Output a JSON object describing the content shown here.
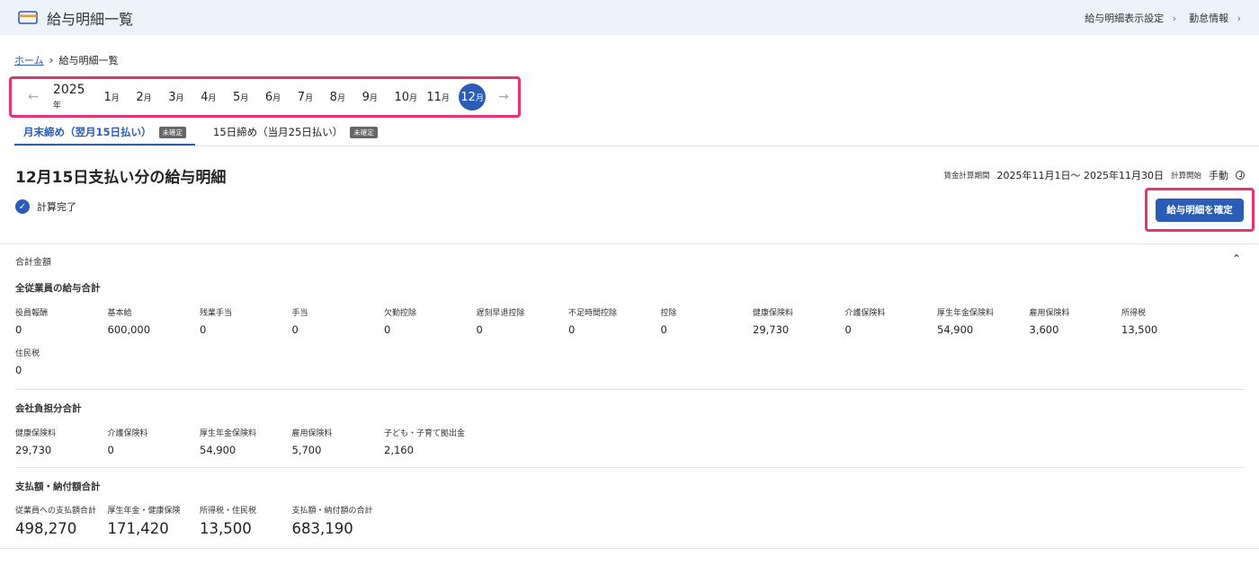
{
  "header": {
    "title": "給与明細一覧",
    "links": [
      "給与明細表示設定",
      "勤怠情報"
    ]
  },
  "breadcrumb": {
    "home": "ホーム",
    "current": "給与明細一覧"
  },
  "months": {
    "year": "2025",
    "year_unit": "年",
    "month_unit": "月",
    "items": [
      "1",
      "2",
      "3",
      "4",
      "5",
      "6",
      "7",
      "8",
      "9",
      "10",
      "11"
    ],
    "active": "12"
  },
  "tabs": [
    {
      "label": "月末締め（翌月15日払い）",
      "badge": "未確定"
    },
    {
      "label": "15日締め（当月25日払い）",
      "badge": "未確定"
    }
  ],
  "main": {
    "heading": "12月15日支払い分の給与明細",
    "period_label": "賃金計算期間",
    "period_value": "2025年11月1日～ 2025年11月30日",
    "calc_label": "計算開始",
    "calc_value": "手動",
    "status": "計算完了",
    "confirm_button": "給与明細を確定",
    "section": "合計金額"
  },
  "employee_totals": {
    "title": "全従業員の給与合計",
    "items": [
      {
        "k": "役員報酬",
        "v": "0"
      },
      {
        "k": "基本給",
        "v": "600,000"
      },
      {
        "k": "残業手当",
        "v": "0"
      },
      {
        "k": "手当",
        "v": "0"
      },
      {
        "k": "欠勤控除",
        "v": "0"
      },
      {
        "k": "遅刻早退控除",
        "v": "0"
      },
      {
        "k": "不足時間控除",
        "v": "0"
      },
      {
        "k": "控除",
        "v": "0"
      },
      {
        "k": "健康保険料",
        "v": "29,730"
      },
      {
        "k": "介護保険料",
        "v": "0"
      },
      {
        "k": "厚生年金保険料",
        "v": "54,900"
      },
      {
        "k": "雇用保険料",
        "v": "3,600"
      },
      {
        "k": "所得税",
        "v": "13,500"
      },
      {
        "k": "住民税",
        "v": "0"
      }
    ]
  },
  "company_totals": {
    "title": "会社負担分合計",
    "items": [
      {
        "k": "健康保険料",
        "v": "29,730"
      },
      {
        "k": "介護保険料",
        "v": "0"
      },
      {
        "k": "厚生年金保険料",
        "v": "54,900"
      },
      {
        "k": "雇用保険料",
        "v": "5,700"
      },
      {
        "k": "子ども・子育て拠出金",
        "v": "2,160"
      }
    ]
  },
  "payment_totals": {
    "title": "支払額・納付額合計",
    "items": [
      {
        "k": "従業員への支払額合計",
        "v": "498,270"
      },
      {
        "k": "厚生年金・健康保険",
        "v": "171,420"
      },
      {
        "k": "所得税・住民税",
        "v": "13,500"
      },
      {
        "k": "支払額・納付額の合計",
        "v": "683,190"
      }
    ]
  },
  "colors": {
    "accent": "#2a5cb8",
    "highlight": "#e8336e",
    "header_bg": "#eef2fb"
  }
}
